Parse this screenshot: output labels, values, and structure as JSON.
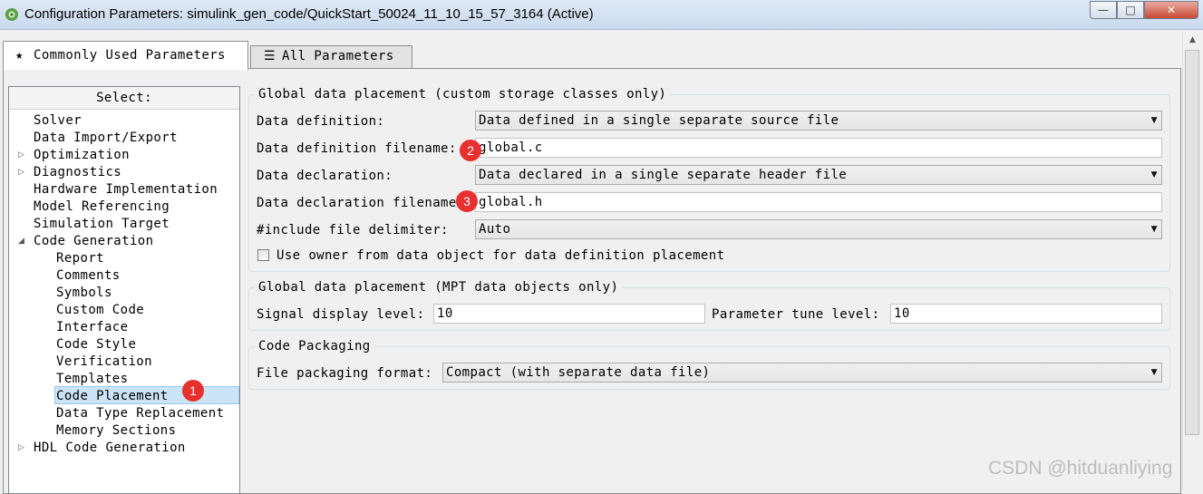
{
  "window": {
    "title": "Configuration Parameters: simulink_gen_code/QuickStart_50024_11_10_15_57_3164 (Active)",
    "controls": {
      "minimize": "—",
      "maximize": "□",
      "close": "✕"
    }
  },
  "tabs": [
    {
      "label": "Commonly Used Parameters",
      "icon": "★",
      "icon_name": "star-icon",
      "active": true
    },
    {
      "label": "All Parameters",
      "icon": "☰",
      "icon_name": "list-icon",
      "active": false
    }
  ],
  "tree": {
    "header": "Select:",
    "items": [
      {
        "label": "Solver",
        "level": 0,
        "expander": ""
      },
      {
        "label": "Data Import/Export",
        "level": 0,
        "expander": ""
      },
      {
        "label": "Optimization",
        "level": 0,
        "expander": "▷"
      },
      {
        "label": "Diagnostics",
        "level": 0,
        "expander": "▷"
      },
      {
        "label": "Hardware Implementation",
        "level": 0,
        "expander": ""
      },
      {
        "label": "Model Referencing",
        "level": 0,
        "expander": ""
      },
      {
        "label": "Simulation Target",
        "level": 0,
        "expander": ""
      },
      {
        "label": "Code Generation",
        "level": 0,
        "expander": "◢"
      },
      {
        "label": "Report",
        "level": 1,
        "expander": ""
      },
      {
        "label": "Comments",
        "level": 1,
        "expander": ""
      },
      {
        "label": "Symbols",
        "level": 1,
        "expander": ""
      },
      {
        "label": "Custom Code",
        "level": 1,
        "expander": ""
      },
      {
        "label": "Interface",
        "level": 1,
        "expander": ""
      },
      {
        "label": "Code Style",
        "level": 1,
        "expander": ""
      },
      {
        "label": "Verification",
        "level": 1,
        "expander": ""
      },
      {
        "label": "Templates",
        "level": 1,
        "expander": ""
      },
      {
        "label": "Code Placement",
        "level": 1,
        "expander": "",
        "selected": true
      },
      {
        "label": "Data Type Replacement",
        "level": 1,
        "expander": ""
      },
      {
        "label": "Memory Sections",
        "level": 1,
        "expander": ""
      },
      {
        "label": "HDL Code Generation",
        "level": 0,
        "expander": "▷"
      }
    ]
  },
  "group_csc": {
    "title": "Global data placement (custom storage classes only)",
    "data_definition_label": "Data definition:",
    "data_definition_value": "Data defined in a single separate source file",
    "data_definition_filename_label": "Data definition filename:",
    "data_definition_filename_value": "global.c",
    "data_declaration_label": "Data declaration:",
    "data_declaration_value": "Data declared in a single separate header file",
    "data_declaration_filename_label": "Data declaration filename:",
    "data_declaration_filename_value": "global.h",
    "include_delimiter_label": "#include file delimiter:",
    "include_delimiter_value": "Auto",
    "owner_checkbox_label": "Use owner from data object for data definition placement",
    "owner_checkbox_checked": false
  },
  "group_mpt": {
    "title": "Global data placement (MPT data objects only)",
    "signal_display_label": "Signal display level:",
    "signal_display_value": "10",
    "parameter_tune_label": "Parameter tune level:",
    "parameter_tune_value": "10"
  },
  "group_packaging": {
    "title": "Code Packaging",
    "format_label": "File packaging format:",
    "format_value": "Compact (with separate data file)"
  },
  "badges": [
    "1",
    "2",
    "3"
  ],
  "watermark": "CSDN @hitduanliying",
  "colors": {
    "badge": "#e8302f",
    "selection": "#cce4f7"
  }
}
